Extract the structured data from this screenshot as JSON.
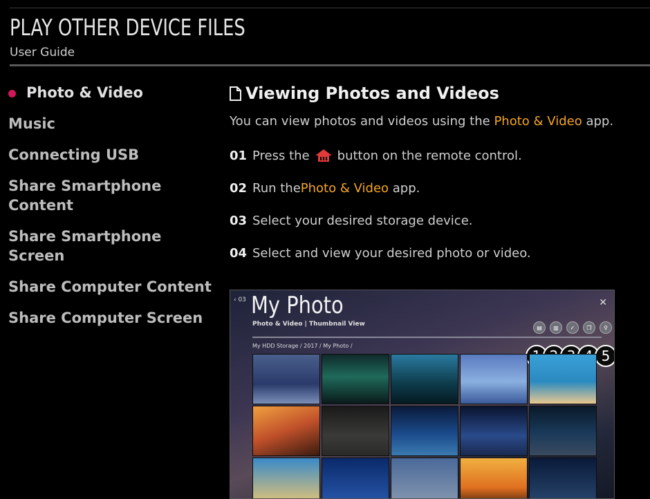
{
  "header": {
    "title": "PLAY OTHER DEVICE FILES",
    "subtitle": "User Guide"
  },
  "sidebar": {
    "items": [
      {
        "label": "Photo & Video",
        "active": true
      },
      {
        "label": "Music"
      },
      {
        "label": "Connecting USB"
      },
      {
        "label": "Share Smartphone Content"
      },
      {
        "label": "Share Smartphone Screen"
      },
      {
        "label": "Share Computer Content"
      },
      {
        "label": "Share Computer Screen"
      }
    ]
  },
  "main": {
    "title": "Viewing Photos and Videos",
    "intro_before": "You can view photos and videos using the ",
    "intro_app": "Photo & Video",
    "intro_after": " app.",
    "steps": [
      {
        "num": "01",
        "before": "Press the",
        "icon": "home-icon",
        "after": "button on the remote control."
      },
      {
        "num": "02",
        "before": "Run the ",
        "app": "Photo & Video",
        "after": " app."
      },
      {
        "num": "03",
        "text": "Select your desired storage device."
      },
      {
        "num": "04",
        "text": "Select and view your desired photo or video."
      }
    ]
  },
  "screenshot": {
    "back": "‹ 03",
    "title": "My Photo",
    "subtitle": "Photo & Video  |  Thumbnail View",
    "path": "My HDD Storage / 2017 / My Photo /",
    "close": "✕",
    "callouts": [
      "1",
      "2",
      "3",
      "4",
      "5"
    ]
  },
  "colors": {
    "accent": "#f5a623",
    "active_dot": "#d3175a",
    "home_icon": "#e03a3a"
  }
}
